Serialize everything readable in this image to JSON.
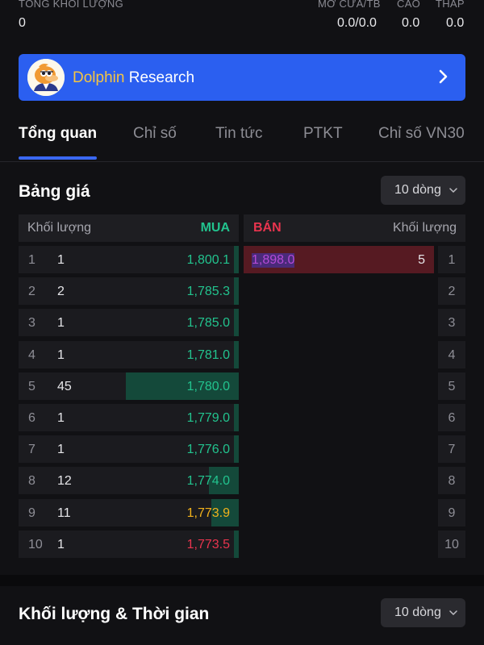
{
  "top_stats": {
    "total_volume": {
      "label": "TỔNG KHỐI LƯỢNG",
      "value": "0"
    },
    "open_avg": {
      "label": "MỞ CỬA/TB",
      "value": "0.0/0.0"
    },
    "high": {
      "label": "CAO",
      "value": "0.0"
    },
    "low": {
      "label": "THẤP",
      "value": "0.0"
    }
  },
  "banner": {
    "brand": "Dolphin",
    "title_rest": "Research",
    "icon": "chevron-right-icon"
  },
  "tabs": [
    "Tổng quan",
    "Chỉ số",
    "Tin tức",
    "PTKT",
    "Chỉ số VN30"
  ],
  "price_board": {
    "title": "Bảng giá",
    "dropdown": "10 dòng",
    "headers": {
      "left_volume": "Khối lượng",
      "buy": "MUA",
      "sell": "BÁN",
      "right_volume": "Khối lượng"
    },
    "buy_rows": [
      {
        "idx": "1",
        "qty": "1",
        "price": "1,800.1",
        "qty_num": 1,
        "color": "#22c38e"
      },
      {
        "idx": "2",
        "qty": "2",
        "price": "1,785.3",
        "qty_num": 2,
        "color": "#22c38e"
      },
      {
        "idx": "3",
        "qty": "1",
        "price": "1,785.0",
        "qty_num": 1,
        "color": "#22c38e"
      },
      {
        "idx": "4",
        "qty": "1",
        "price": "1,781.0",
        "qty_num": 1,
        "color": "#22c38e"
      },
      {
        "idx": "5",
        "qty": "45",
        "price": "1,780.0",
        "qty_num": 45,
        "color": "#22c38e"
      },
      {
        "idx": "6",
        "qty": "1",
        "price": "1,779.0",
        "qty_num": 1,
        "color": "#22c38e"
      },
      {
        "idx": "7",
        "qty": "1",
        "price": "1,776.0",
        "qty_num": 1,
        "color": "#22c38e"
      },
      {
        "idx": "8",
        "qty": "12",
        "price": "1,774.0",
        "qty_num": 12,
        "color": "#22c38e"
      },
      {
        "idx": "9",
        "qty": "11",
        "price": "1,773.9",
        "qty_num": 11,
        "color": "#f2b21b"
      },
      {
        "idx": "10",
        "qty": "1",
        "price": "1,773.5",
        "qty_num": 1,
        "color": "#e8344e"
      }
    ],
    "sell_rows": [
      {
        "idx": "1",
        "price": "1,898.0",
        "qty": "5",
        "qty_num": 5,
        "color": "#b54ad6"
      },
      {
        "idx": "2",
        "price": "",
        "qty": "",
        "qty_num": 0
      },
      {
        "idx": "3",
        "price": "",
        "qty": "",
        "qty_num": 0
      },
      {
        "idx": "4",
        "price": "",
        "qty": "",
        "qty_num": 0
      },
      {
        "idx": "5",
        "price": "",
        "qty": "",
        "qty_num": 0
      },
      {
        "idx": "6",
        "price": "",
        "qty": "",
        "qty_num": 0
      },
      {
        "idx": "7",
        "price": "",
        "qty": "",
        "qty_num": 0
      },
      {
        "idx": "8",
        "price": "",
        "qty": "",
        "qty_num": 0
      },
      {
        "idx": "9",
        "price": "",
        "qty": "",
        "qty_num": 0
      },
      {
        "idx": "10",
        "price": "",
        "qty": "",
        "qty_num": 0
      }
    ]
  },
  "volume_time": {
    "title": "Khối lượng & Thời gian",
    "dropdown": "10 dòng"
  }
}
